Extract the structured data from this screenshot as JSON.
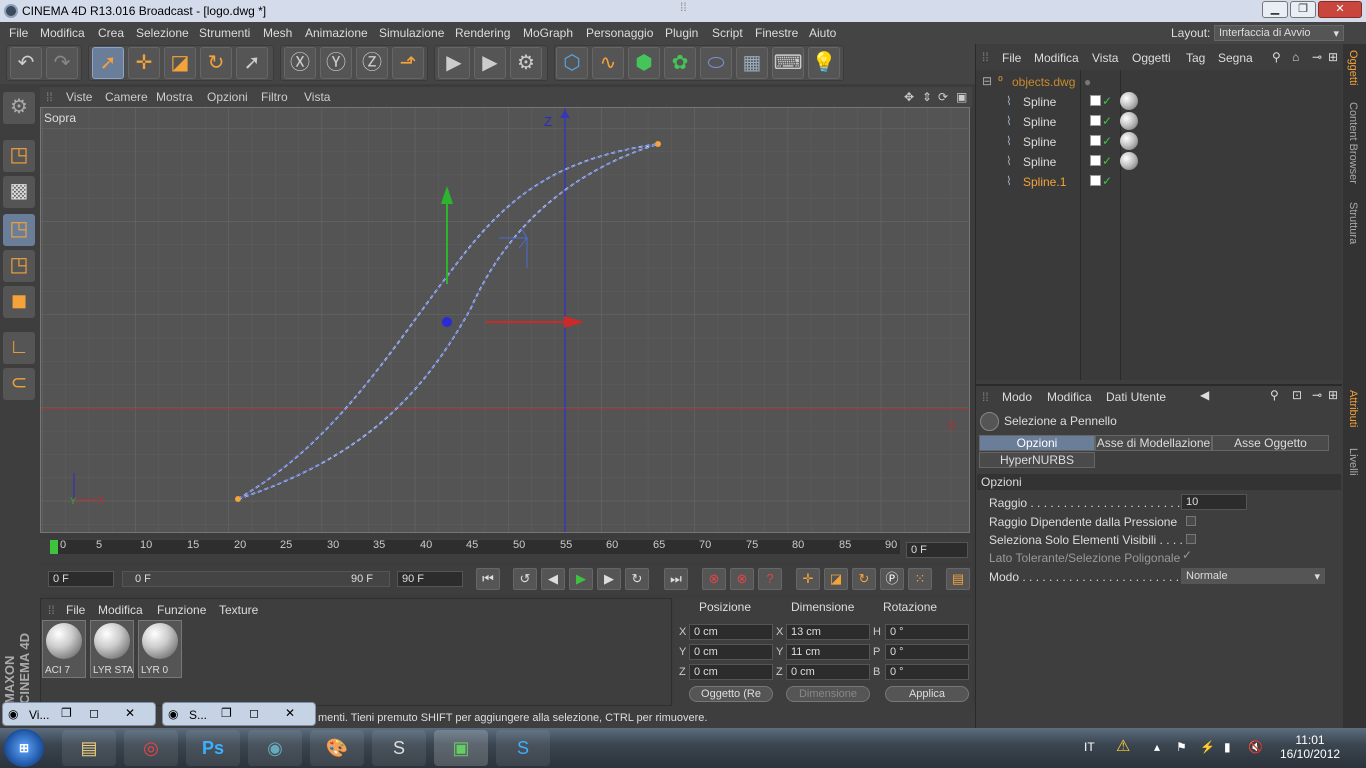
{
  "window": {
    "title": "CINEMA 4D R13.016 Broadcast - [logo.dwg *]",
    "minimize": "▁",
    "restore": "❐",
    "close": "✕"
  },
  "menu": [
    "File",
    "Modifica",
    "Crea",
    "Selezione",
    "Strumenti",
    "Mesh",
    "Animazione",
    "Simulazione",
    "Rendering",
    "MoGraph",
    "Personaggio",
    "Plugin",
    "Script",
    "Finestre",
    "Aiuto"
  ],
  "layout": {
    "label": "Layout:",
    "value": "Interfaccia di Avvio"
  },
  "viewport": {
    "menu": [
      "Viste",
      "Camere",
      "Mostra",
      "Opzioni",
      "Filtro",
      "Vista"
    ],
    "view_name": "Sopra",
    "axis_z": "Z",
    "axis_x": "X",
    "mini_y": "Y",
    "mini_x": "X"
  },
  "timeline": {
    "ticks": [
      "0",
      "5",
      "10",
      "15",
      "20",
      "25",
      "30",
      "35",
      "40",
      "45",
      "50",
      "55",
      "60",
      "65",
      "70",
      "75",
      "80",
      "85",
      "90"
    ],
    "current": "0 F",
    "start": "0 F",
    "range_start": "0 F",
    "range_end": "90 F",
    "end": "90 F"
  },
  "materials": {
    "menu": [
      "File",
      "Modifica",
      "Funzione",
      "Texture"
    ],
    "items": [
      "ACI 7",
      "LYR STAI",
      "LYR 0"
    ]
  },
  "coords": {
    "headers": [
      "Posizione",
      "Dimensione",
      "Rotazione"
    ],
    "rows": [
      {
        "a": "X",
        "pos": "0 cm",
        "b": "X",
        "dim": "13 cm",
        "c": "H",
        "rot": "0 °"
      },
      {
        "a": "Y",
        "pos": "0 cm",
        "b": "Y",
        "dim": "11 cm",
        "c": "P",
        "rot": "0 °"
      },
      {
        "a": "Z",
        "pos": "0 cm",
        "b": "Z",
        "dim": "0 cm",
        "c": "B",
        "rot": "0 °"
      }
    ],
    "mode": "Oggetto (Re",
    "dimension_mode": "Dimensione",
    "apply": "Applica"
  },
  "status": "menti. Tieni premuto SHIFT per aggiungere alla selezione, CTRL per rimuovere.",
  "minimized": [
    "Vi...",
    "S..."
  ],
  "maxon": "MAXON CINEMA 4D",
  "objects": {
    "menu": [
      "File",
      "Modifica",
      "Vista",
      "Oggetti",
      "Tag",
      "Segna"
    ],
    "root": "objects.dwg",
    "items": [
      "Spline",
      "Spline",
      "Spline",
      "Spline",
      "Spline.1"
    ]
  },
  "sidetabs": [
    "Oggetti",
    "Content Browser",
    "Struttura",
    "Attributi",
    "Livelli"
  ],
  "attributes": {
    "menu": [
      "Modo",
      "Modifica",
      "Dati Utente"
    ],
    "tool": "Selezione a Pennello",
    "tabs": [
      "Opzioni",
      "Asse di Modellazione",
      "Asse Oggetto",
      "HyperNURBS"
    ],
    "section": "Opzioni",
    "raggio_label": "Raggio . . . . . . . . . . . . . . . . . . . . . . . .",
    "raggio": "10",
    "opt1": "Raggio Dipendente dalla Pressione",
    "opt2": "Seleziona Solo Elementi Visibili . . . .",
    "opt3": "Lato Tolerante/Selezione Poligonale",
    "modo_label": "Modo . . . . . . . . . . . . . . . . . . . . . . . . . .",
    "modo": "Normale"
  },
  "taskbar": {
    "lang": "IT",
    "time": "11:01",
    "date": "16/10/2012",
    "apps": [
      "explorer-icon",
      "chrome-icon",
      "photoshop-icon",
      "cinema4d-icon",
      "paint-icon",
      "sketchbook-icon",
      "remote-icon",
      "skype-icon"
    ]
  },
  "colors": {
    "accent": "#f3a33a",
    "selection": "#6a7d99",
    "axis_x": "#cc2a2a",
    "axis_y": "#2cb52c",
    "axis_z": "#2a2ac4",
    "highlight_obj": "#f3a33a"
  }
}
